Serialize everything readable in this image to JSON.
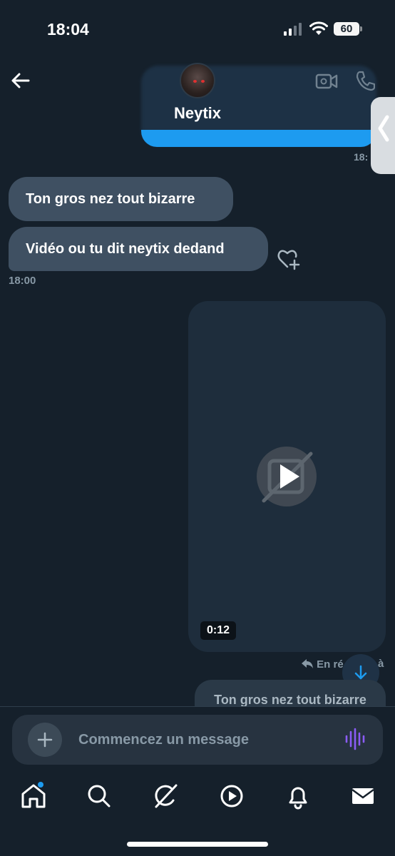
{
  "status_bar": {
    "time": "18:04",
    "battery": "60"
  },
  "header": {
    "contact_name": "Neytix",
    "icons": {
      "back": "arrow-left-icon",
      "video": "video-call-icon",
      "phone": "phone-call-icon"
    }
  },
  "partial_sent_time": "18:",
  "messages": [
    {
      "text": "Ton gros nez tout bizarre",
      "direction": "incoming"
    },
    {
      "text": "Vidéo ou tu dit neytix dedand",
      "direction": "incoming"
    }
  ],
  "incoming_time": "18:00",
  "video_message": {
    "duration": "0:12"
  },
  "reply": {
    "label": "En ré",
    "trailing": "à",
    "quoted_text": "Ton gros nez tout bizarre"
  },
  "composer": {
    "placeholder": "Commencez un message"
  },
  "tab_bar": {
    "items": [
      "home-icon",
      "search-icon",
      "grok-icon",
      "video-icon",
      "bell-icon",
      "mail-icon"
    ],
    "home_has_badge": true
  },
  "colors": {
    "background": "#15202b",
    "incoming_bubble": "#3f5062",
    "accent": "#1d9bf0",
    "voice_accent": "#8b5cf6"
  }
}
